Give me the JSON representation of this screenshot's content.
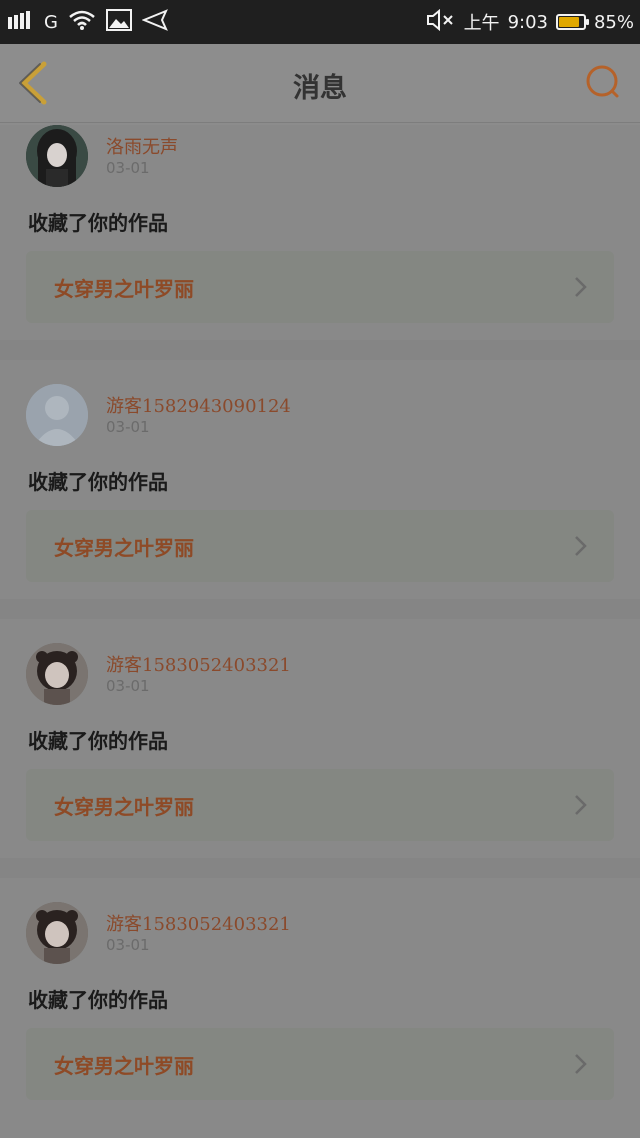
{
  "status_bar": {
    "network": "G",
    "time_prefix": "上午",
    "time": "9:03",
    "battery_percent_label": "85%",
    "battery_level": 0.85
  },
  "header": {
    "title": "消息"
  },
  "colors": {
    "accent": "#d9782f",
    "overlay_bg": "#8c8c8c"
  },
  "messages": [
    {
      "username": "洛雨无声",
      "date": "03-01",
      "action": "收藏了你的作品",
      "work_title": "女穿男之叶罗丽",
      "avatar": "dark-hair-girl-avatar"
    },
    {
      "username": "游客1582943090124",
      "date": "03-01",
      "action": "收藏了你的作品",
      "work_title": "女穿男之叶罗丽",
      "avatar": "default-user-avatar"
    },
    {
      "username": "游客1583052403321",
      "date": "03-01",
      "action": "收藏了你的作品",
      "work_title": "女穿男之叶罗丽",
      "avatar": "girl-photo-avatar"
    },
    {
      "username": "游客1583052403321",
      "date": "03-01",
      "action": "收藏了你的作品",
      "work_title": "女穿男之叶罗丽",
      "avatar": "girl-photo-avatar"
    }
  ]
}
